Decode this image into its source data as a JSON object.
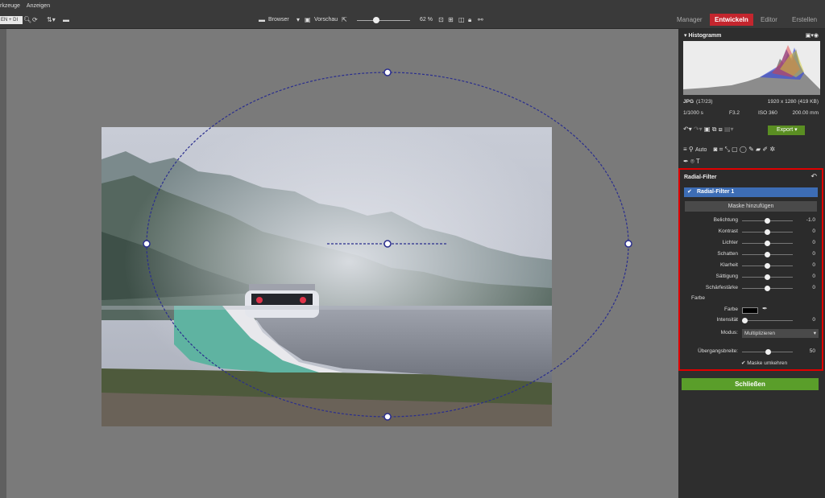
{
  "menu": {
    "item1": "rkzeuge",
    "item2": "Anzeigen"
  },
  "toolbar": {
    "search_text": "EN + DI",
    "browser_label": "Browser",
    "preview_label": "Vorschau",
    "zoom_value": "62 %"
  },
  "modes": {
    "manager": "Manager",
    "develop": "Entwickeln",
    "editor": "Editor",
    "create": "Erstellen"
  },
  "histogram": {
    "title": "Histogramm",
    "format": "JPG",
    "index": "(17/23)",
    "dimensions": "1920 x 1280 (419 KB)",
    "shutter": "1/1000 s",
    "aperture": "F3.2",
    "iso": "ISO 360",
    "focal": "200.00 mm"
  },
  "tools": {
    "auto_label": "Auto",
    "export_label": "Export"
  },
  "radial_filter": {
    "title": "Radial-Filter",
    "item_label": "Radial-Filter 1",
    "add_mask_label": "Maske hinzufügen",
    "sliders": [
      {
        "label": "Belichtung",
        "value": "-1.0",
        "level": 0.5
      },
      {
        "label": "Kontrast",
        "value": "0",
        "level": 0.5
      },
      {
        "label": "Lichter",
        "value": "0",
        "level": 0.5
      },
      {
        "label": "Schatten",
        "value": "0",
        "level": 0.5
      },
      {
        "label": "Klarheit",
        "value": "0",
        "level": 0.5
      },
      {
        "label": "Sättigung",
        "value": "0",
        "level": 0.5
      },
      {
        "label": "Schärfestärke",
        "value": "0",
        "level": 0.5
      }
    ],
    "color_section": "Farbe",
    "color_label": "Farbe",
    "intensity_label": "Intensität",
    "intensity_value": "0",
    "mode_label": "Modus:",
    "mode_value": "Multiplizieren",
    "transition_label": "Übergangsbreite:",
    "transition_value": "50",
    "invert_label": "Maske umkehren",
    "close_label": "Schließen"
  }
}
